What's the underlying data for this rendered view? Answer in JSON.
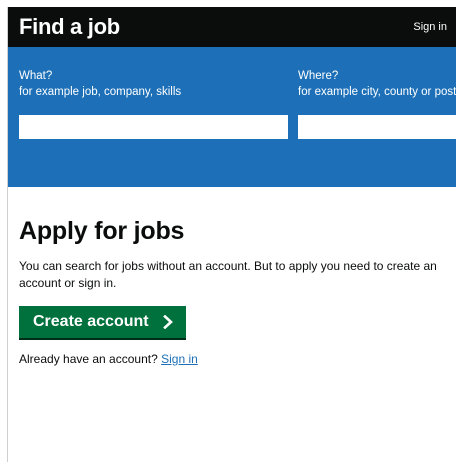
{
  "header": {
    "title": "Find a job",
    "sign_in": "Sign in"
  },
  "search": {
    "what_label": "What?",
    "what_hint": "for example job, company, skills",
    "where_label": "Where?",
    "where_hint": "for example city, county or postcode",
    "what_value": "",
    "where_value": ""
  },
  "main": {
    "title": "Apply for jobs",
    "intro": "You can search for jobs without an account. But to apply you need to create an account or sign in.",
    "create_button": "Create account",
    "already_text": "Already have an account? ",
    "sign_in_link": "Sign in"
  },
  "colors": {
    "header_bg": "#0b0c0c",
    "search_bg": "#1d70b8",
    "button_bg": "#00703c",
    "link": "#1d70b8"
  },
  "icons": {
    "button_icon": "chevron-right-icon"
  }
}
